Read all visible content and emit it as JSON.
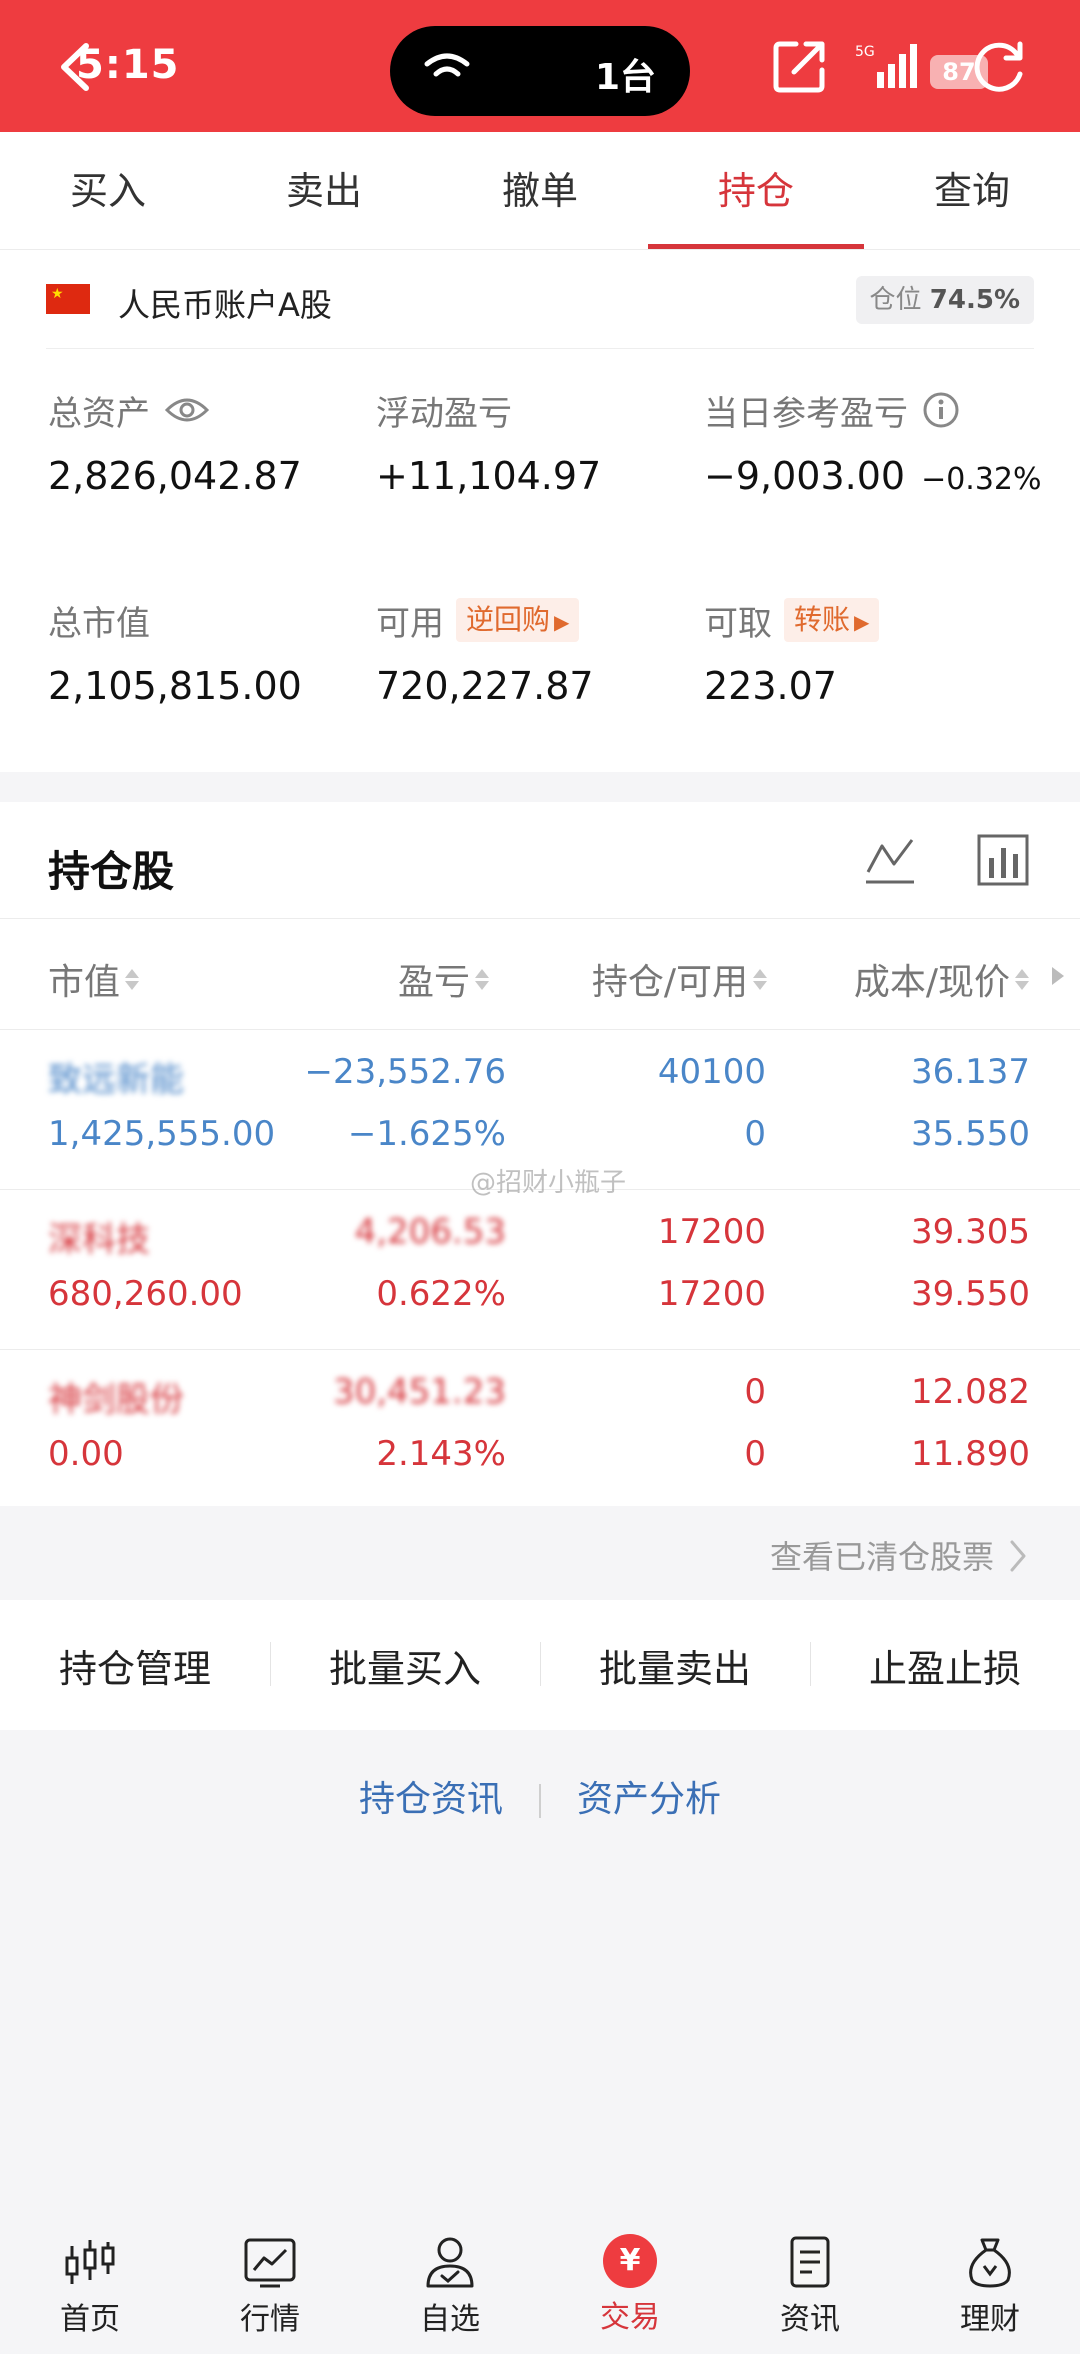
{
  "status": {
    "time": "5:15",
    "island_text": "1台",
    "battery": "87"
  },
  "tabs": [
    {
      "label": "买入"
    },
    {
      "label": "卖出"
    },
    {
      "label": "撤单"
    },
    {
      "label": "持仓",
      "active": true
    },
    {
      "label": "查询"
    }
  ],
  "account": {
    "name": "人民币账户A股",
    "ratio_label": "仓位",
    "ratio_value": "74.5%",
    "total_assets": {
      "label": "总资产",
      "value": "2,826,042.87"
    },
    "floating_pl": {
      "label": "浮动盈亏",
      "value": "+11,104.97"
    },
    "daily_pl": {
      "label": "当日参考盈亏",
      "value": "−9,003.00",
      "pct": "−0.32%"
    },
    "market_value": {
      "label": "总市值",
      "value": "2,105,815.00"
    },
    "available": {
      "label": "可用",
      "tag": "逆回购",
      "value": "720,227.87"
    },
    "withdrawable": {
      "label": "可取",
      "tag": "转账",
      "value": "223.07"
    }
  },
  "holdings": {
    "title": "持仓股",
    "columns": [
      "市值",
      "盈亏",
      "持仓/可用",
      "成本/现价"
    ],
    "rows": [
      {
        "color": "blue",
        "name": "致远新能",
        "market_value": "1,425,555.00",
        "pl": "−23,552.76",
        "pl_pct": "−1.625%",
        "position": "40100",
        "available": "0",
        "cost": "36.137",
        "price": "35.550"
      },
      {
        "color": "red",
        "name": "深科技",
        "market_value": "680,260.00",
        "pl": "4,206.53",
        "pl_pct": "0.622%",
        "position": "17200",
        "available": "17200",
        "cost": "39.305",
        "price": "39.550"
      },
      {
        "color": "red",
        "name": "神剑股份",
        "market_value": "0.00",
        "pl": "30,451.23",
        "pl_pct": "2.143%",
        "position": "0",
        "available": "0",
        "cost": "12.082",
        "price": "11.890"
      }
    ],
    "watermark": "@招财小瓶子"
  },
  "cleared_link": "查看已清仓股票",
  "actions": [
    "持仓管理",
    "批量买入",
    "批量卖出",
    "止盈止损"
  ],
  "links": [
    "持仓资讯",
    "资产分析"
  ],
  "bottom_nav": [
    {
      "label": "首页",
      "icon": "candlestick-icon"
    },
    {
      "label": "行情",
      "icon": "chart-icon"
    },
    {
      "label": "自选",
      "icon": "user-check-icon"
    },
    {
      "label": "交易",
      "icon": "yen-icon",
      "active": true
    },
    {
      "label": "资讯",
      "icon": "document-icon"
    },
    {
      "label": "理财",
      "icon": "money-bag-icon"
    }
  ],
  "colors": {
    "accent": "#ee3c40",
    "loss": "#4a86c8",
    "gain": "#d6353b",
    "tag": "#e06a2e"
  }
}
